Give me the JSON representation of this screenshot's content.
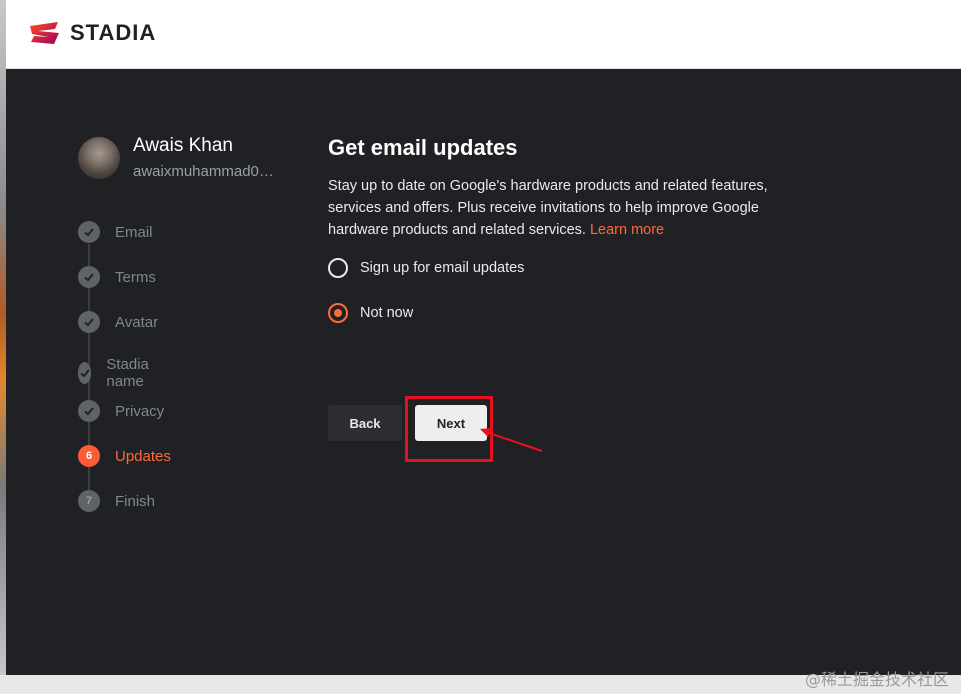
{
  "header": {
    "logo_text": "STADIA",
    "brand_color": "#ff4c1d"
  },
  "user": {
    "name": "Awais Khan",
    "email": "awaixmuhammad05..."
  },
  "steps": [
    {
      "label": "Email",
      "status": "done",
      "icon": "check-icon"
    },
    {
      "label": "Terms",
      "status": "done",
      "icon": "check-icon"
    },
    {
      "label": "Avatar",
      "status": "done",
      "icon": "check-icon"
    },
    {
      "label": "Stadia name",
      "status": "done",
      "icon": "check-icon"
    },
    {
      "label": "Privacy",
      "status": "done",
      "icon": "check-icon"
    },
    {
      "label": "Updates",
      "status": "active",
      "number": "6"
    },
    {
      "label": "Finish",
      "status": "todo",
      "number": "7"
    }
  ],
  "content": {
    "title": "Get email updates",
    "description": "Stay up to date on Google's hardware products and related features, services and offers. Plus receive invitations to help improve Google hardware products and related services.",
    "learn_more": "Learn more",
    "options": [
      {
        "label": "Sign up for email updates",
        "checked": false
      },
      {
        "label": "Not now",
        "checked": true
      }
    ]
  },
  "buttons": {
    "back": "Back",
    "next": "Next"
  },
  "annotation": {
    "highlight_color": "#e8101e"
  },
  "watermark": "@稀土掘金技术社区"
}
